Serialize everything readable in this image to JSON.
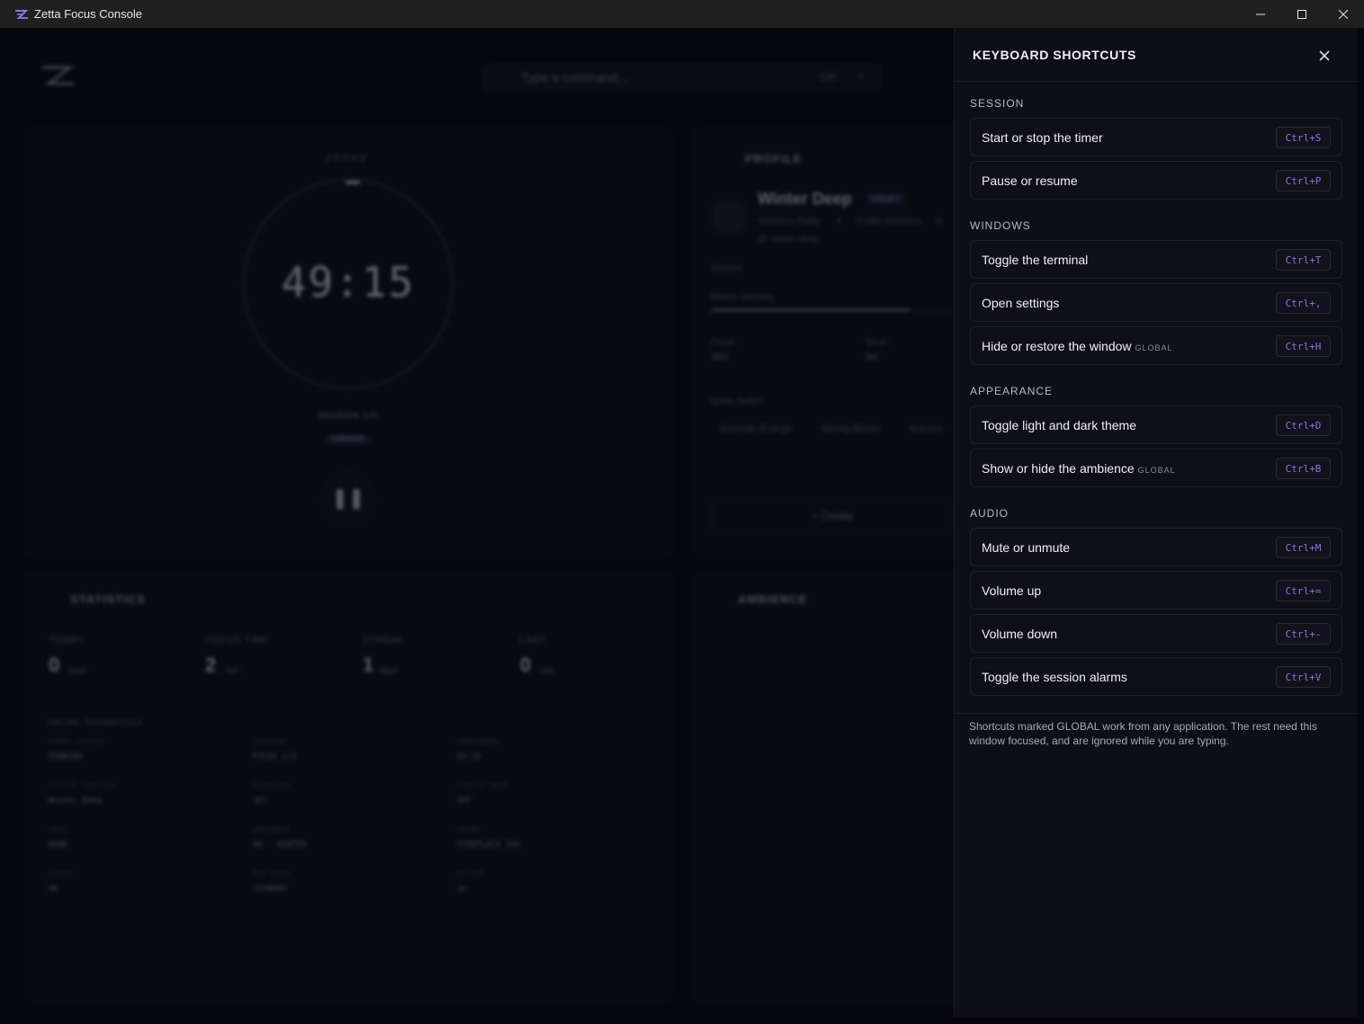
{
  "window": {
    "title": "Zetta Focus Console",
    "icon": "zetta-logo-icon",
    "controls": [
      "minimize-icon",
      "maximize-icon",
      "close-icon"
    ]
  },
  "background": {
    "command_bar": {
      "placeholder": "Type a command...",
      "shortcut_1": "Ctrl",
      "shortcut_2": "!"
    },
    "timer": {
      "mode_label": "FOCUS",
      "time": "49:15",
      "session": "SESSION 1/3",
      "badge": "OVERRIDE"
    },
    "profile": {
      "title": "PROFILE",
      "name": "Winter Deep",
      "tag": "PRESET",
      "meta_1": "Sessions Today",
      "meta_1_value": "4",
      "meta_2": "Profile Sessions",
      "meta_2_value": "4",
      "id_line": "ID: winter-deep",
      "season_label": "Season",
      "motion_label": "Motion Intensity",
      "motion_level": 0.82,
      "focus_label": "Focus",
      "focus_value": "25m",
      "short_label": "Short",
      "short_value": "5m",
      "quick_switch_label": "Quick Switch",
      "quick_switch": [
        "Summer Energy",
        "Spring Bloom",
        "Autumn"
      ],
      "create_label": "+ Create"
    },
    "statistics": {
      "title": "STATISTICS",
      "stats": [
        {
          "label": "TODAY",
          "value": "0",
          "unit": "sess"
        },
        {
          "label": "FOCUS TIME",
          "value": "2",
          "unit": "min"
        },
        {
          "label": "STREAK",
          "value": "1",
          "unit": "days"
        },
        {
          "label": "LAST",
          "value": "0",
          "unit": "min"
        }
      ],
      "diagnostics_title": "ENGINE DIAGNOSTICS",
      "diagnostics": [
        {
          "k": "TIMER STATUS",
          "v": "RUNNING"
        },
        {
          "k": "SESSION",
          "v": "FOCUS 1/3"
        },
        {
          "k": "REMAINING",
          "v": "49:15"
        },
        {
          "k": "ACTIVE PROFILE",
          "v": "Winter Deep"
        },
        {
          "k": "OVERRIDE",
          "v": "SET"
        },
        {
          "k": "STRICT MODE",
          "v": "OFF"
        },
        {
          "k": "TASK",
          "v": "NONE"
        },
        {
          "k": "AMBIENCE",
          "v": "ON · WINTER"
        },
        {
          "k": "SOUND",
          "v": "FIREPLACE 50%"
        },
        {
          "k": "ALARM",
          "v": "ON"
        },
        {
          "k": "DEV MODE",
          "v": "STANDBY"
        },
        {
          "k": "UPTIME",
          "v": "1m"
        }
      ]
    },
    "ambience": {
      "title": "AMBIENCE"
    }
  },
  "shortcuts": {
    "title": "KEYBOARD SHORTCUTS",
    "global_tag": "GLOBAL",
    "groups": [
      {
        "label": "SESSION",
        "items": [
          {
            "label": "Start or stop the timer",
            "keys": "Ctrl+S",
            "global": false
          },
          {
            "label": "Pause or resume",
            "keys": "Ctrl+P",
            "global": false
          }
        ]
      },
      {
        "label": "WINDOWS",
        "items": [
          {
            "label": "Toggle the terminal",
            "keys": "Ctrl+T",
            "global": false
          },
          {
            "label": "Open settings",
            "keys": "Ctrl+,",
            "global": false
          },
          {
            "label": "Hide or restore the window",
            "keys": "Ctrl+H",
            "global": true
          }
        ]
      },
      {
        "label": "APPEARANCE",
        "items": [
          {
            "label": "Toggle light and dark theme",
            "keys": "Ctrl+D",
            "global": false
          },
          {
            "label": "Show or hide the ambience",
            "keys": "Ctrl+B",
            "global": true
          }
        ]
      },
      {
        "label": "AUDIO",
        "items": [
          {
            "label": "Mute or unmute",
            "keys": "Ctrl+M",
            "global": false
          },
          {
            "label": "Volume up",
            "keys": "Ctrl+=",
            "global": false
          },
          {
            "label": "Volume down",
            "keys": "Ctrl+-",
            "global": false
          },
          {
            "label": "Toggle the session alarms",
            "keys": "Ctrl+V",
            "global": false
          }
        ]
      }
    ],
    "footnote": "Shortcuts marked GLOBAL work from any application. The rest need this window focused, and are ignored while you are typing."
  },
  "colors": {
    "accent": "#8c74e0",
    "panel_bg": "#0e0e16",
    "titlebar_bg": "#202020"
  }
}
